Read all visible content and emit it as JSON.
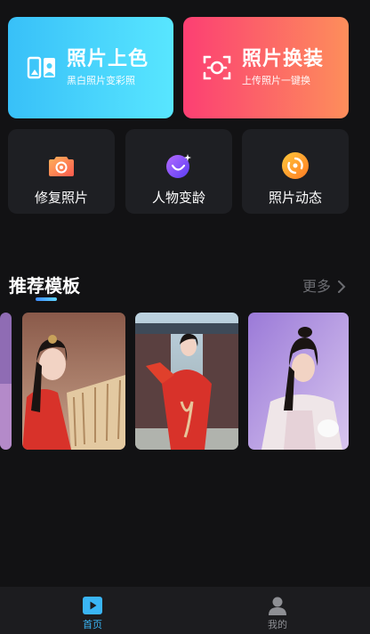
{
  "feature_cards": {
    "colorize": {
      "title": "照片上色",
      "subtitle": "黑白照片变彩照",
      "icon": "photo-portrait-icon"
    },
    "swap": {
      "title": "照片换装",
      "subtitle": "上传照片一键换",
      "icon": "face-scan-icon"
    }
  },
  "tools": [
    {
      "label": "修复照片",
      "icon": "camera-icon"
    },
    {
      "label": "人物变龄",
      "icon": "moon-planet-icon"
    },
    {
      "label": "照片动态",
      "icon": "swirl-icon"
    }
  ],
  "templates": {
    "title": "推荐模板",
    "more_label": "更多"
  },
  "tabbar": {
    "home_label": "首页",
    "mine_label": "我的",
    "active_color": "#3ab5f5",
    "inactive_color": "#8e8f94"
  },
  "colors": {
    "colorize_gradient": [
      "#38c0f8",
      "#58e6ff"
    ],
    "swap_gradient": [
      "#fc3f73",
      "#fd8e5b"
    ],
    "background": "#121214"
  }
}
